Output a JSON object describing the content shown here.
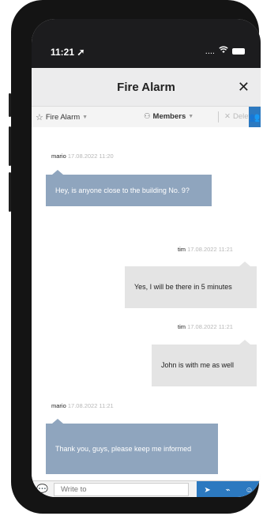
{
  "status": {
    "time": "11:21",
    "signal": "....",
    "wifi_icon": "wifi-icon",
    "battery_icon": "battery-icon"
  },
  "header": {
    "title": "Fire Alarm",
    "close_icon": "close-icon"
  },
  "toolbar": {
    "channel_label": "Fire Alarm",
    "members_label": "Members",
    "delete_label": "Delete"
  },
  "messages": [
    {
      "user": "mario",
      "time": "17.08.2022 11:20",
      "text": "Hey, is anyone close to the building No. 9?",
      "side": "left"
    },
    {
      "user": "tim",
      "time": "17.08.2022 11:21",
      "text": "Yes, I will be there in 5 minutes",
      "side": "right"
    },
    {
      "user": "tim",
      "time": "17.08.2022 11:21",
      "text": "John is with me as well",
      "side": "right"
    },
    {
      "user": "mario",
      "time": "17.08.2022 11:21",
      "text": "Thank you, guys, please keep me informed",
      "side": "left"
    }
  ],
  "composer": {
    "placeholder": "Write to"
  },
  "colors": {
    "accent": "#2c79c0",
    "bubble_left": "#8fa5be",
    "bubble_right": "#e4e4e4"
  }
}
